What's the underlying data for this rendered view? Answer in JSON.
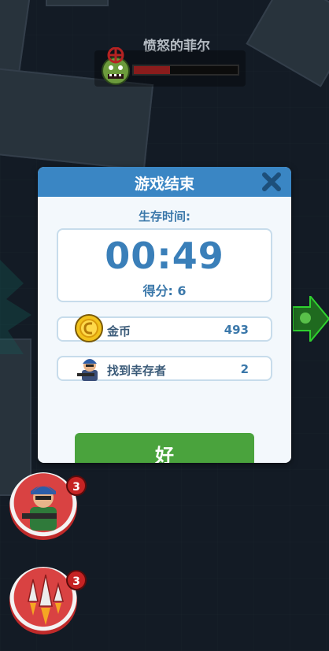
{
  "boss": {
    "name": "愤怒的菲尔",
    "health_fraction": 0.35
  },
  "dialog": {
    "title": "游戏结束",
    "survival_label": "生存时间:",
    "time": "00:49",
    "score_label": "得分: 6",
    "coins_label": "金币",
    "coins_value": "493",
    "survivors_label": "找到幸存者",
    "survivors_value": "2",
    "ok_label": "好"
  },
  "hud": {
    "soldier_count": "3",
    "rocket_count": "3"
  },
  "colors": {
    "header": "#3a86c4",
    "accent_text": "#3b78aa",
    "ok_button": "#4aa33d",
    "badge": "#c62323",
    "boss_health": "#8a1c1c"
  },
  "icons": [
    "zombie-boss-icon",
    "close-icon",
    "coin-icon",
    "survivor-icon",
    "soldier-icon",
    "rocket-icon",
    "arrow-right-icon"
  ]
}
